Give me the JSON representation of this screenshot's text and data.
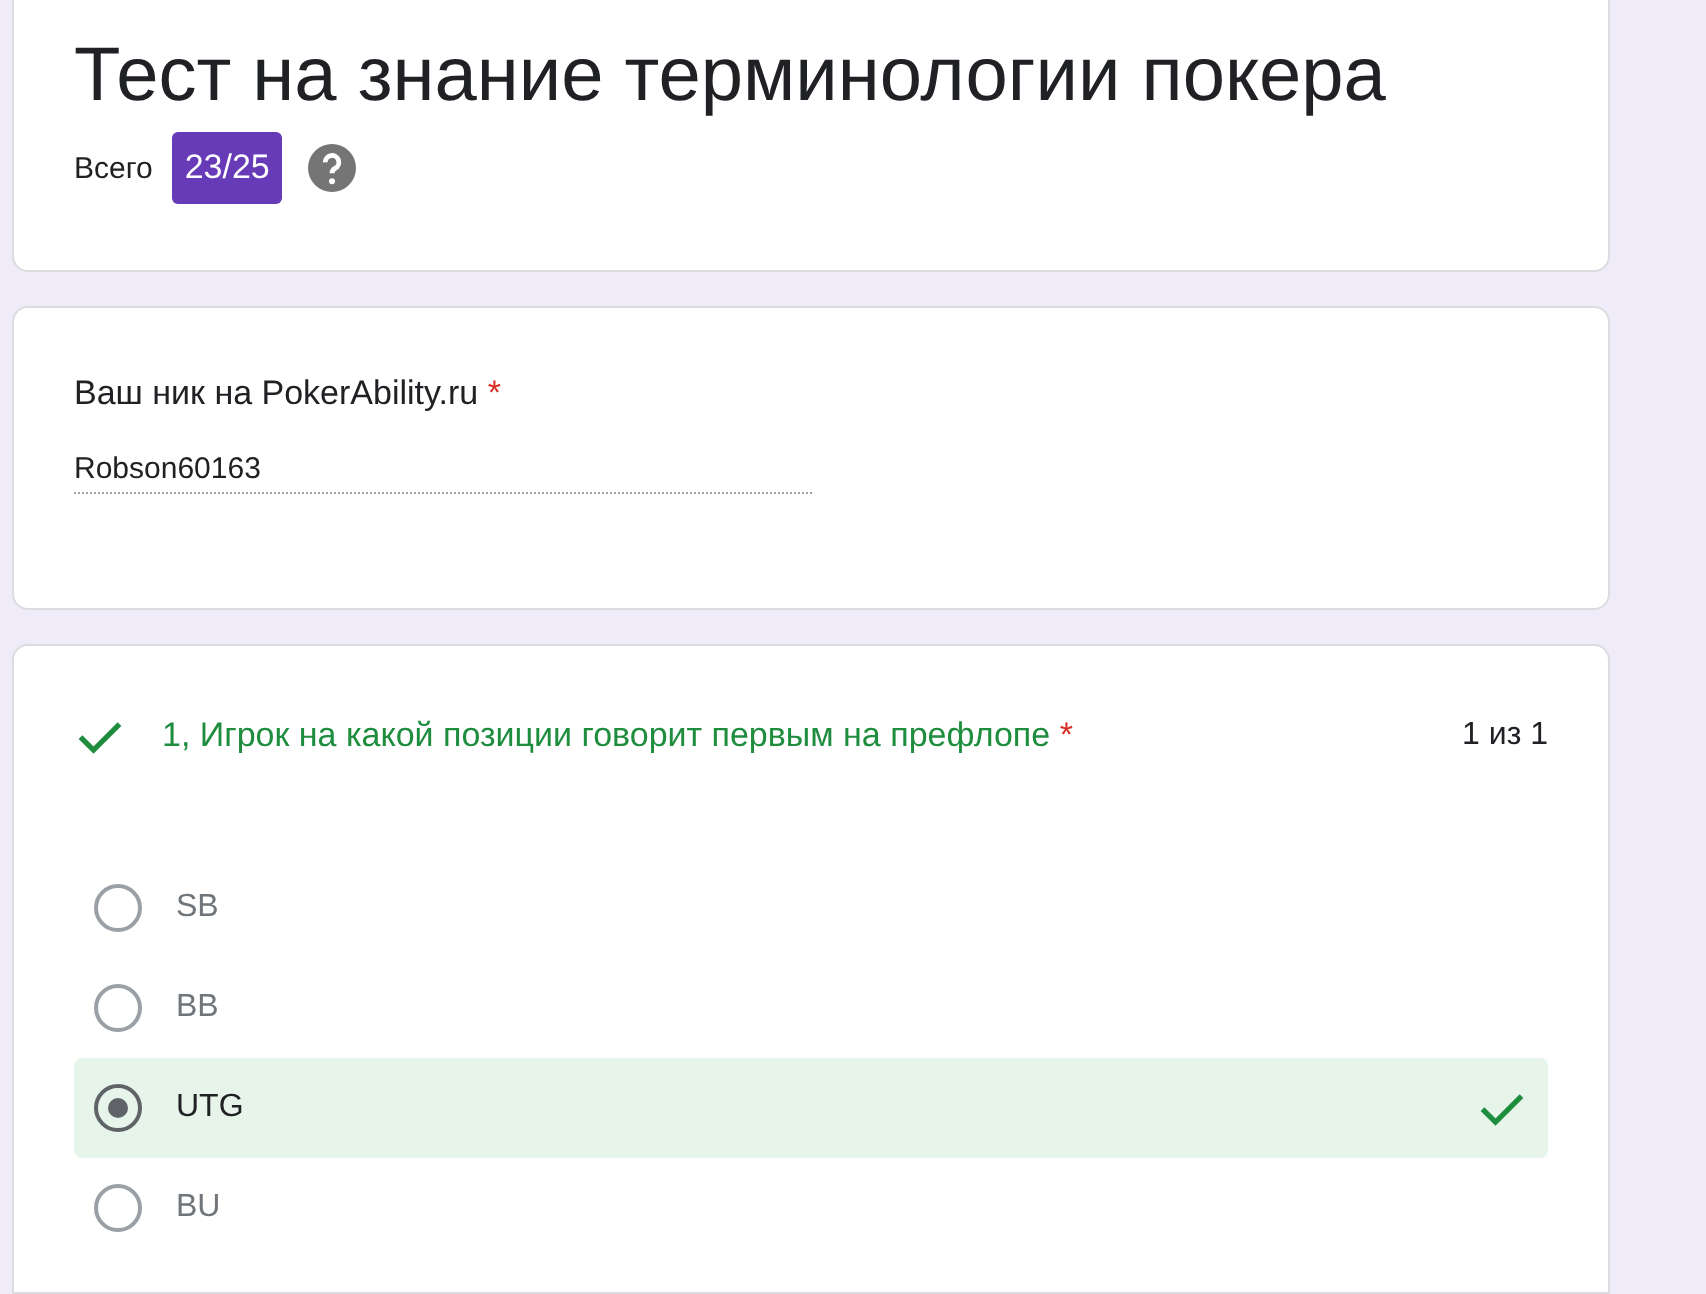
{
  "header": {
    "title": "Тест на знание терминологии покера",
    "total_label": "Всего",
    "score": "23/25"
  },
  "name_question": {
    "label": "Ваш ник на PokerAbility.ru",
    "required": true,
    "required_mark": "*",
    "value": "Robson60163"
  },
  "questions": [
    {
      "title": "1, Игрок на какой позиции говорит первым на префлопе",
      "required": true,
      "required_mark": "*",
      "correct": true,
      "points": "1 из 1",
      "options": [
        {
          "label": "SB",
          "selected": false,
          "correct": false
        },
        {
          "label": "BB",
          "selected": false,
          "correct": false
        },
        {
          "label": "UTG",
          "selected": true,
          "correct": true
        },
        {
          "label": "BU",
          "selected": false,
          "correct": false
        }
      ]
    }
  ]
}
